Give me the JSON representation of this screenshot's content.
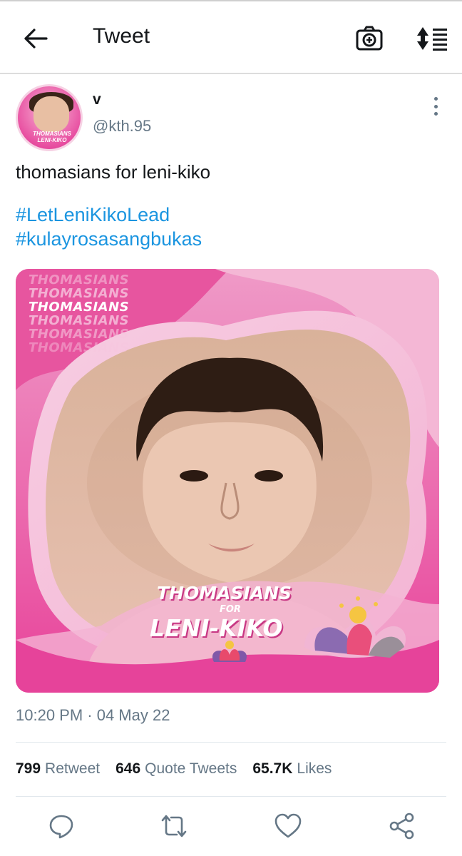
{
  "header": {
    "title": "Tweet"
  },
  "tweet": {
    "author": {
      "display_name": "v",
      "handle": "@kth.95"
    },
    "text": "thomasians for leni-kiko",
    "hashtags": [
      "#LetLeniKikoLead",
      "#kulayrosasangbukas"
    ],
    "timestamp": "10:20 PM · 04 May 22",
    "media": {
      "watermark_lines": [
        "THOMASIANS",
        "THOMASIANS",
        "THOMASIANS",
        "THOMASIANS",
        "THOMASIANS",
        "THOMASIANS"
      ],
      "headline": "THOMASIANS",
      "for": "FOR",
      "subline": "LENI-KIKO"
    },
    "avatar_text": {
      "line1": "THOMASIANS",
      "line2": "LENI-KIKO"
    },
    "stats": {
      "retweets": {
        "count": "799",
        "label": "Retweet"
      },
      "quotes": {
        "count": "646",
        "label": "Quote Tweets"
      },
      "likes": {
        "count": "65.7K",
        "label": "Likes"
      }
    }
  },
  "colors": {
    "link": "#1b95e0",
    "secondary": "#657786",
    "brand_pink": "#e8439a"
  },
  "icons": {
    "back": "arrow-left-icon",
    "camera": "camera-add-icon",
    "sort": "sort-icon",
    "more": "more-vertical-icon",
    "reply": "reply-icon",
    "retweet": "retweet-icon",
    "like": "heart-icon",
    "share": "share-icon"
  }
}
